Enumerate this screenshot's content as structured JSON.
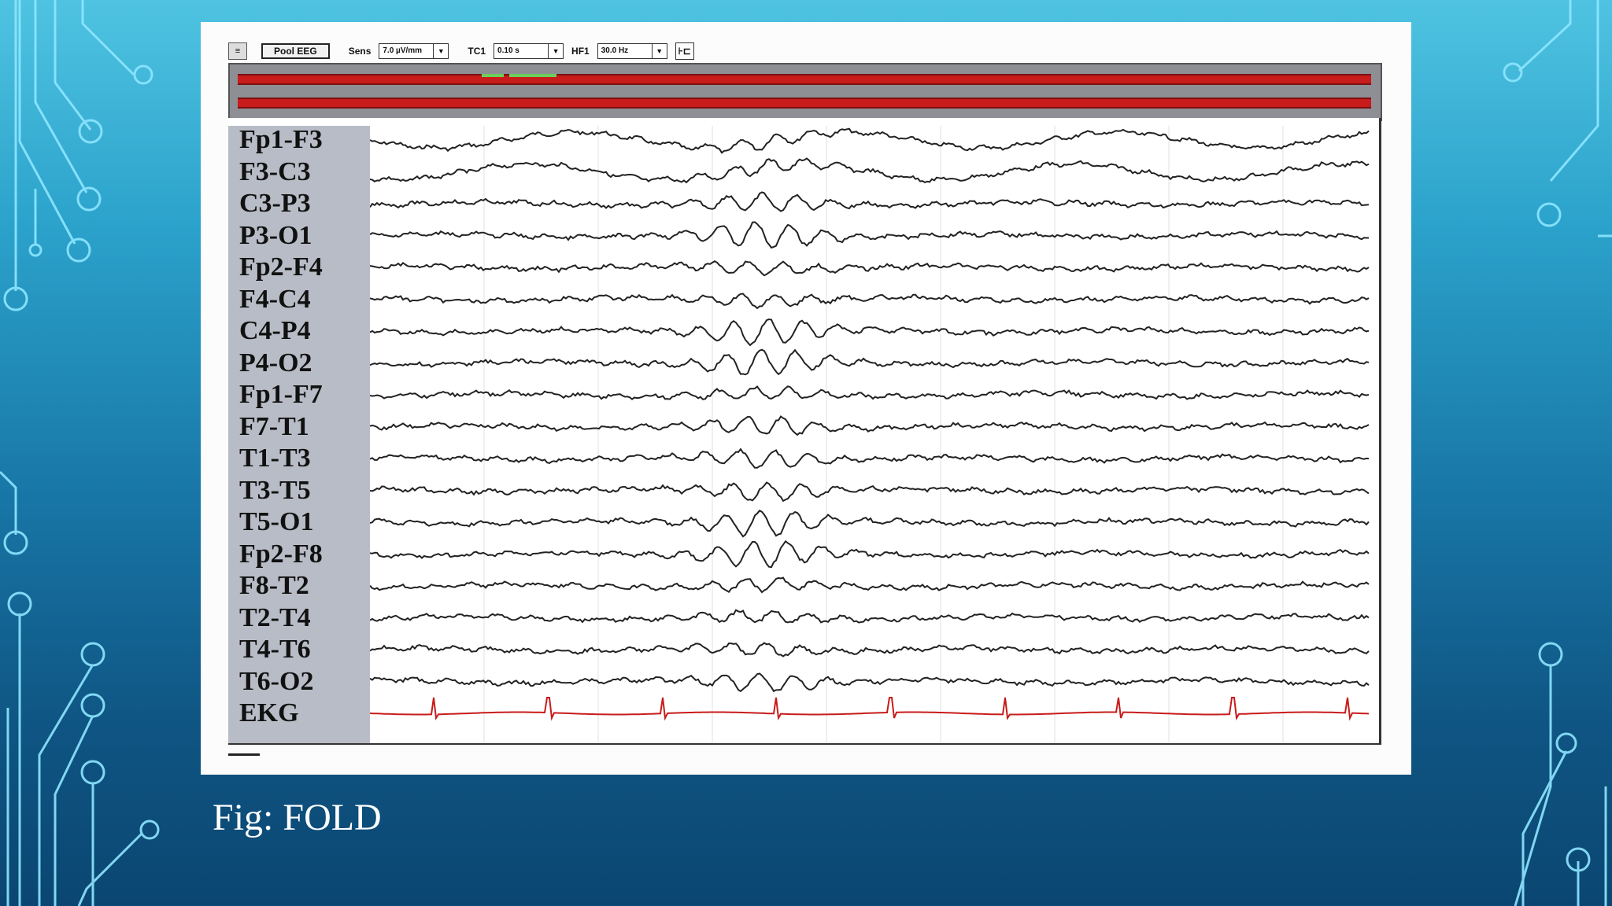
{
  "toolbar": {
    "montage_button": "Pool EEG",
    "sens_label": "Sens",
    "sens_value": "7.0 µV/mm",
    "tc_label": "TC1",
    "tc_value": "0.10 s",
    "hf_label": "HF1",
    "hf_value": "30.0 Hz",
    "end_button": "⊦⊏"
  },
  "channels": [
    "Fp1-F3",
    "F3-C3",
    "C3-P3",
    "P3-O1",
    "Fp2-F4",
    "F4-C4",
    "C4-P4",
    "P4-O2",
    "Fp1-F7",
    "F7-T1",
    "T1-T3",
    "T3-T5",
    "T5-O1",
    "Fp2-F8",
    "F8-T2",
    "T2-T4",
    "T4-T6",
    "T6-O2",
    "EKG"
  ],
  "caption": "Fig: FOLD",
  "colors": {
    "trace": "#222222",
    "ekg": "#c81b1b",
    "track_red": "#c81b1b",
    "label_bg": "#b8bcc6"
  }
}
